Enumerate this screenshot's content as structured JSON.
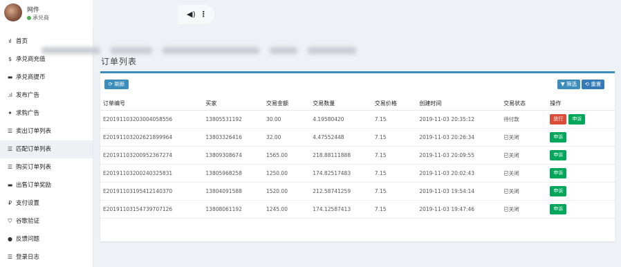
{
  "profile": {
    "name": "网件",
    "role": "承兑商"
  },
  "sidebar": {
    "items": [
      {
        "icon": "bar-chart-icon",
        "glyph": "ıl",
        "label": "首页"
      },
      {
        "icon": "dollar-icon",
        "glyph": "$",
        "label": "承兑商充值"
      },
      {
        "icon": "card-icon",
        "glyph": "▬",
        "label": "承兑商提币"
      },
      {
        "icon": "signal-icon",
        "glyph": ".ıl",
        "label": "发布广告"
      },
      {
        "icon": "ad-icon",
        "glyph": "✦",
        "label": "求购广告"
      },
      {
        "icon": "list-icon",
        "glyph": "☰",
        "label": "卖出订单列表"
      },
      {
        "icon": "list-icon",
        "glyph": "☰",
        "label": "匹配订单列表"
      },
      {
        "icon": "list-icon",
        "glyph": "☰",
        "label": "购买订单列表"
      },
      {
        "icon": "card-icon",
        "glyph": "▬",
        "label": "出售订单奖励"
      },
      {
        "icon": "payment-icon",
        "glyph": "₽",
        "label": "支付设置"
      },
      {
        "icon": "shield-icon",
        "glyph": "⛉",
        "label": "谷歌验证"
      },
      {
        "icon": "comment-icon",
        "glyph": "●",
        "label": "反馈问题"
      },
      {
        "icon": "list-icon",
        "glyph": "☰",
        "label": "登录日志"
      }
    ],
    "active_index": 6
  },
  "topbar": {
    "sound_glyph": "◀)",
    "more_glyph": "⋮"
  },
  "card": {
    "title": "订单列表",
    "refresh_label": "⟳ 刷新",
    "filter_label": "▼ 筛选",
    "reset_label": "⟲ 重置"
  },
  "table": {
    "headers": [
      "订单编号",
      "买家",
      "交易金额",
      "交易数量",
      "交易价格",
      "创建时间",
      "交易状态",
      "操作"
    ],
    "rows": [
      {
        "order": "E20191103203004058556",
        "buyer": "13805531192",
        "amount": "30.00",
        "qty": "4.19580420",
        "price": "7.15",
        "time": "2019-11-03 20:35:12",
        "status": "待付款",
        "actions": [
          "放行",
          "申诉"
        ]
      },
      {
        "order": "E20191103202621899964",
        "buyer": "13803326416",
        "amount": "32.00",
        "qty": "4.47552448",
        "price": "7.15",
        "time": "2019-11-03 20:26:34",
        "status": "已关闭",
        "actions": [
          "申诉"
        ]
      },
      {
        "order": "E20191103200952367274",
        "buyer": "13809308674",
        "amount": "1565.00",
        "qty": "218.88111888",
        "price": "7.15",
        "time": "2019-11-03 20:09:55",
        "status": "已关闭",
        "actions": [
          "申诉"
        ]
      },
      {
        "order": "E20191103200240325831",
        "buyer": "13805968258",
        "amount": "1250.00",
        "qty": "174.82517483",
        "price": "7.15",
        "time": "2019-11-03 20:02:43",
        "status": "已关闭",
        "actions": [
          "申诉"
        ]
      },
      {
        "order": "E20191103195412140370",
        "buyer": "13804091588",
        "amount": "1520.00",
        "qty": "212.58741259",
        "price": "7.15",
        "time": "2019-11-03 19:54:14",
        "status": "已关闭",
        "actions": [
          "申诉"
        ]
      },
      {
        "order": "E20191103154739707126",
        "buyer": "13808061192",
        "amount": "1245.00",
        "qty": "174.12587413",
        "price": "7.15",
        "time": "2019-11-03 19:47:46",
        "status": "已关闭",
        "actions": [
          "申诉"
        ]
      }
    ]
  },
  "colors": {
    "accent": "#3c8dbc",
    "success": "#00a65a",
    "danger": "#dd4b39"
  }
}
